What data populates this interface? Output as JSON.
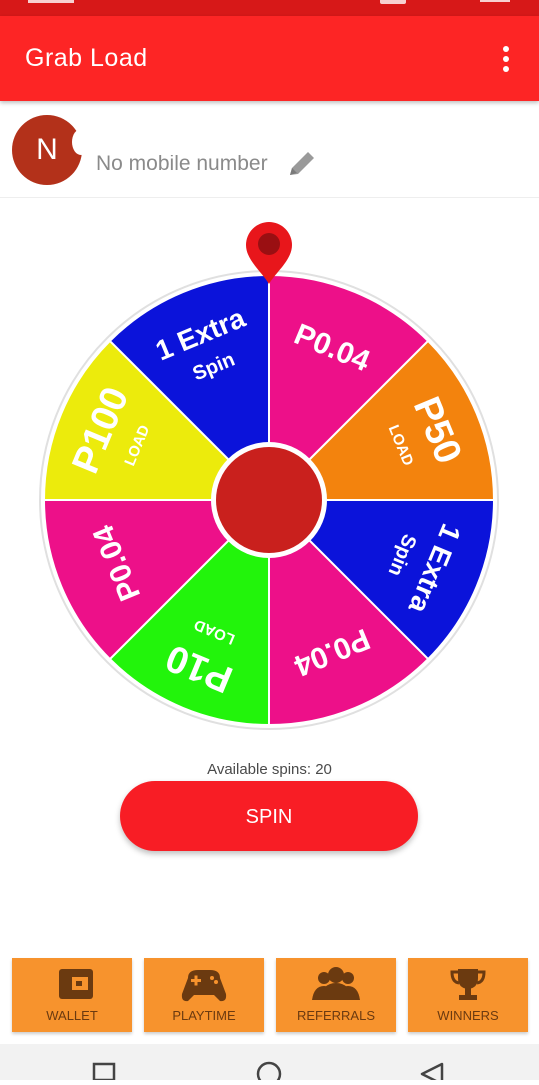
{
  "app_bar": {
    "title": "Grab Load",
    "menu_icon": "more-vert-icon"
  },
  "profile": {
    "avatar_initial": "N",
    "name": "",
    "mobile": "No mobile number",
    "edit_icon": "pencil-icon"
  },
  "wheel": {
    "segments": [
      {
        "main": "P0.04",
        "sub": "",
        "color": "#ed1089"
      },
      {
        "main": "P50",
        "sub": "LOAD",
        "color": "#f3830d"
      },
      {
        "main": "1 Extra",
        "sub": "Spin",
        "color": "#0b13da"
      },
      {
        "main": "P0.04",
        "sub": "",
        "color": "#ed1089"
      },
      {
        "main": "P10",
        "sub": "LOAD",
        "color": "#22f40b"
      },
      {
        "main": "P0.04",
        "sub": "",
        "color": "#ed1089"
      },
      {
        "main": "P100",
        "sub": "LOAD",
        "color": "#eceb0c"
      },
      {
        "main": "1 Extra",
        "sub": "Spin",
        "color": "#0b13da"
      }
    ],
    "center_color": "#c9201d",
    "pointer_color": "#e8161b"
  },
  "spins": {
    "label": "Available spins: 20",
    "button": "SPIN"
  },
  "bottom_nav": [
    {
      "label": "WALLET",
      "icon": "wallet-icon"
    },
    {
      "label": "PLAYTIME",
      "icon": "gamepad-icon"
    },
    {
      "label": "REFERRALS",
      "icon": "group-icon"
    },
    {
      "label": "WINNERS",
      "icon": "trophy-icon"
    }
  ],
  "system_nav": {
    "back": "back-icon",
    "home": "home-icon",
    "recents": "recents-icon"
  }
}
